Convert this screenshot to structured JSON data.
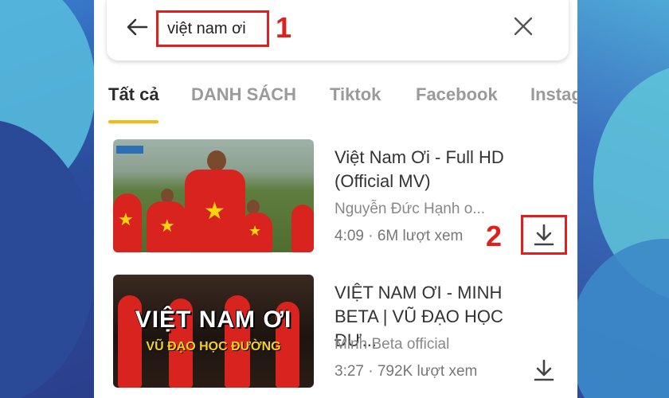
{
  "search": {
    "query": "việt nam ơi"
  },
  "markers": [
    "1",
    "2"
  ],
  "tabs": [
    {
      "label": "Tất cả",
      "active": true
    },
    {
      "label": "DANH SÁCH",
      "active": false
    },
    {
      "label": "Tiktok",
      "active": false
    },
    {
      "label": "Facebook",
      "active": false
    },
    {
      "label": "Instagram",
      "active": false
    }
  ],
  "results": [
    {
      "title": "Việt Nam Ơi - Full HD (Official MV)",
      "channel": "Nguyễn Đức Hạnh o...",
      "meta": "4:09 · 6M lượt xem"
    },
    {
      "title": "VIỆT NAM ƠI - MINH BETA | VŨ ĐẠO HỌC ĐƯ...",
      "channel": "Minh Beta official",
      "meta": "3:27 · 792K lượt xem",
      "thumb_text": "VIỆT NAM ƠI",
      "thumb_subtext": "VŨ ĐẠO HỌC ĐƯỜNG"
    }
  ],
  "icons": {
    "back": "arrow-left-icon",
    "clear": "close-icon",
    "download": "download-icon"
  },
  "colors": {
    "accent": "#f6b911",
    "highlight": "#e0201f"
  }
}
